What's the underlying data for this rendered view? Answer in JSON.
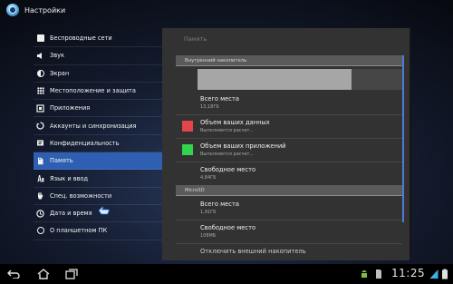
{
  "action_bar": {
    "title": "Настройки",
    "app_icon": "settings-app-icon"
  },
  "sidebar": {
    "items": [
      {
        "label": "Беспроводные сети",
        "icon": "square-icon",
        "selected": false
      },
      {
        "label": "Звук",
        "icon": "speaker-icon",
        "selected": false
      },
      {
        "label": "Экран",
        "icon": "brightness-icon",
        "selected": false
      },
      {
        "label": "Местоположение и защита",
        "icon": "grid-icon",
        "selected": false
      },
      {
        "label": "Приложения",
        "icon": "apps-icon",
        "selected": false
      },
      {
        "label": "Аккаунты и синхронизация",
        "icon": "sync-icon",
        "selected": false
      },
      {
        "label": "Конфиденциальность",
        "icon": "privacy-icon",
        "selected": false
      },
      {
        "label": "Память",
        "icon": "storage-icon",
        "selected": true
      },
      {
        "label": "Язык и ввод",
        "icon": "language-icon",
        "selected": false
      },
      {
        "label": "Спец. возможности",
        "icon": "hand-icon",
        "selected": false
      },
      {
        "label": "Дата и время",
        "icon": "clock-icon",
        "selected": false
      },
      {
        "label": "О планшетном ПК",
        "icon": "info-icon",
        "selected": false
      }
    ]
  },
  "panel": {
    "title": "Память",
    "internal_header": "Внутренний накопитель",
    "usage_fraction": 0.75,
    "rows_internal": [
      {
        "title": "Всего места",
        "subtitle": "13,18ГБ",
        "color": null
      },
      {
        "title": "Объем ваших данных",
        "subtitle": "Выполняется расчет...",
        "color": "#e2454a"
      },
      {
        "title": "Объем ваших приложений",
        "subtitle": "Выполняется расчет...",
        "color": "#31d44a"
      },
      {
        "title": "Свободное место",
        "subtitle": "4,84ГБ",
        "color": null
      }
    ],
    "microsd_header": "MicroSD",
    "rows_microsd": [
      {
        "title": "Всего места",
        "subtitle": "1,91ГБ"
      },
      {
        "title": "Свободное место",
        "subtitle": "108МБ"
      },
      {
        "title": "Отключить внешний накопитель",
        "subtitle": ""
      }
    ]
  },
  "system_bar": {
    "time": "11:25"
  }
}
